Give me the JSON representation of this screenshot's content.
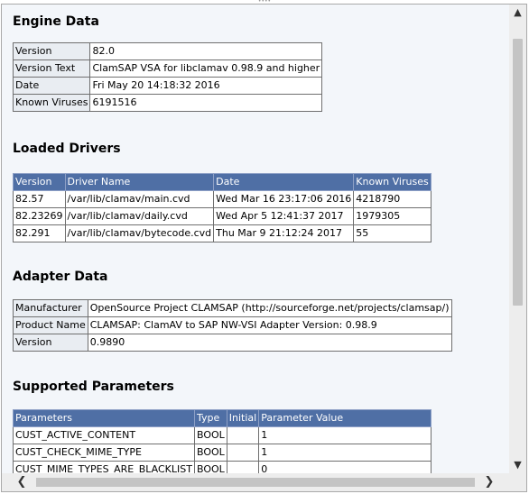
{
  "engine": {
    "title": "Engine Data",
    "rows": [
      {
        "key": "Version",
        "value": "82.0"
      },
      {
        "key": "Version Text",
        "value": "ClamSAP VSA for libclamav 0.98.9 and higher"
      },
      {
        "key": "Date",
        "value": "Fri May 20 14:18:32 2016"
      },
      {
        "key": "Known Viruses",
        "value": "6191516"
      }
    ]
  },
  "drivers": {
    "title": "Loaded Drivers",
    "headers": [
      "Version",
      "Driver Name",
      "Date",
      "Known Viruses"
    ],
    "rows": [
      [
        "82.57",
        "/var/lib/clamav/main.cvd",
        "Wed Mar 16 23:17:06 2016",
        "4218790"
      ],
      [
        "82.23269",
        "/var/lib/clamav/daily.cvd",
        "Wed Apr 5 12:41:37 2017",
        "1979305"
      ],
      [
        "82.291",
        "/var/lib/clamav/bytecode.cvd",
        "Thu Mar 9 21:12:24 2017",
        "55"
      ]
    ]
  },
  "adapter": {
    "title": "Adapter Data",
    "rows": [
      {
        "key": "Manufacturer",
        "value": "OpenSource Project CLAMSAP (http://sourceforge.net/projects/clamsap/)"
      },
      {
        "key": "Product Name",
        "value": "CLAMSAP: ClamAV to SAP NW-VSI Adapter Version: 0.98.9"
      },
      {
        "key": "Version",
        "value": "0.9890"
      }
    ]
  },
  "params": {
    "title": "Supported Parameters",
    "headers": [
      "Parameters",
      "Type",
      "Initial",
      "Parameter Value"
    ],
    "rows": [
      [
        "CUST_ACTIVE_CONTENT",
        "BOOL",
        "",
        "1"
      ],
      [
        "CUST_CHECK_MIME_TYPE",
        "BOOL",
        "",
        "1"
      ],
      [
        "CUST_MIME_TYPES_ARE_BLACKLIST",
        "BOOL",
        "",
        "0"
      ]
    ]
  },
  "scrollbars": {
    "up_icon": "▲",
    "down_icon": "▼",
    "left_icon": "❮",
    "right_icon": "❯"
  }
}
